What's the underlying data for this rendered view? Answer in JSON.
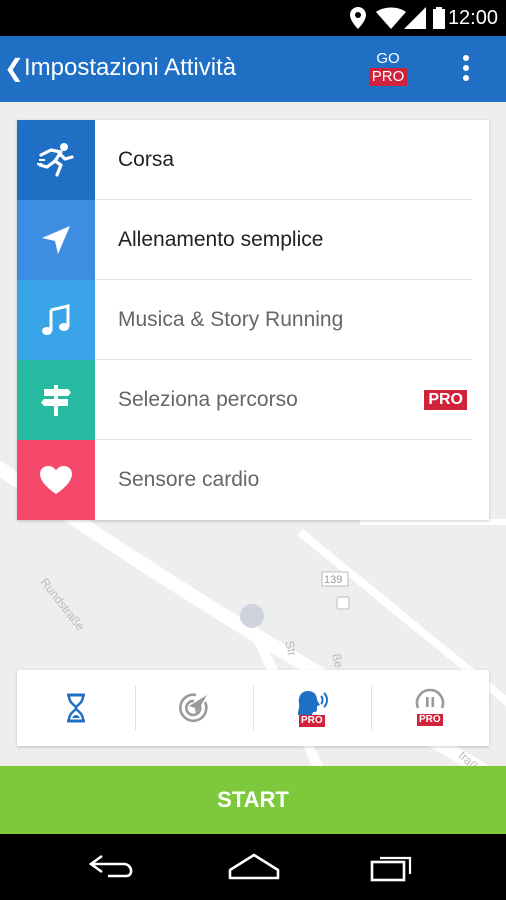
{
  "status_bar": {
    "time": "12:00"
  },
  "app_bar": {
    "back_glyph": "❮",
    "title": "Impostazioni Attività",
    "go_label": "GO",
    "pro_label": "PRO"
  },
  "settings_list": [
    {
      "label": "Corsa",
      "icon": "running-person-icon",
      "color": "#1f6fc5",
      "text_color": "#222222"
    },
    {
      "label": "Allenamento semplice",
      "icon": "navigation-arrow-icon",
      "color": "#3d8ee3",
      "text_color": "#222222"
    },
    {
      "label": "Musica & Story Running",
      "icon": "music-note-icon",
      "color": "#3aa4e8",
      "text_color": "#666666"
    },
    {
      "label": "Seleziona percorso",
      "icon": "signpost-icon",
      "color": "#26bba1",
      "text_color": "#666666",
      "badge": "PRO"
    },
    {
      "label": "Sensore cardio",
      "icon": "heart-icon",
      "color": "#f4496b",
      "text_color": "#666666"
    }
  ],
  "bottom_toolbar": {
    "items": [
      {
        "icon": "hourglass-icon"
      },
      {
        "icon": "speed-target-icon"
      },
      {
        "icon": "voice-coach-icon",
        "badge": "PRO"
      },
      {
        "icon": "auto-pause-icon",
        "badge": "PRO"
      }
    ]
  },
  "map": {
    "labels": [
      "Rundstraße",
      "Str",
      "139",
      "ße",
      "traße"
    ]
  },
  "start_button": {
    "label": "START",
    "color": "#7dc93b"
  },
  "colors": {
    "app_bar": "#1f6fc5",
    "pro_badge": "#d0223a"
  }
}
